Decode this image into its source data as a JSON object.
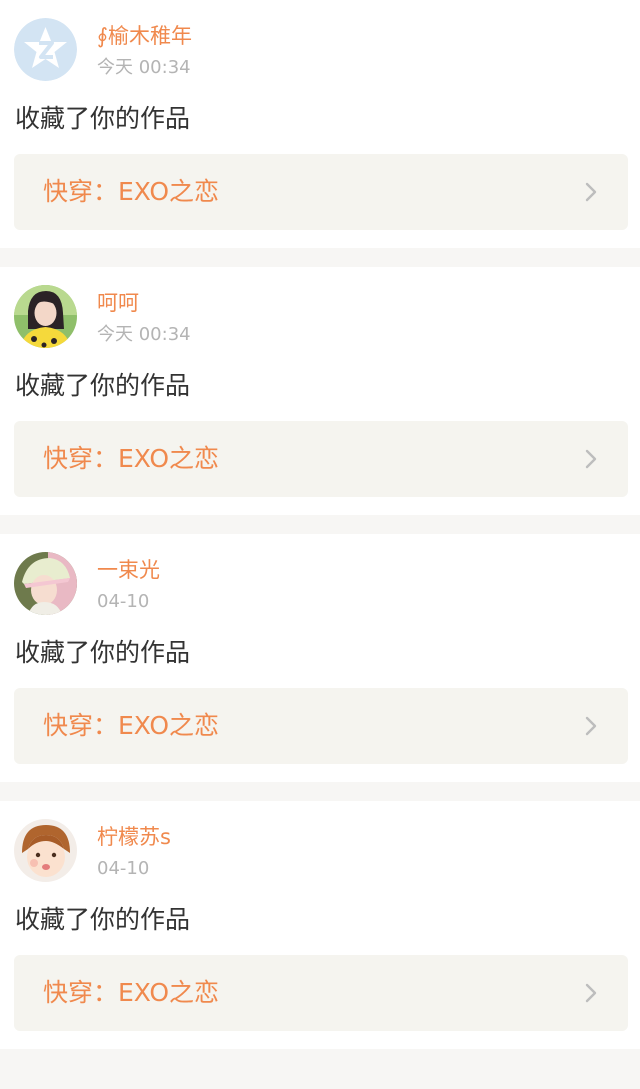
{
  "feed": [
    {
      "user": "∮榆木稚年",
      "time": "今天 00:34",
      "action": "收藏了你的作品",
      "work_title": "快穿：EXO之恋",
      "avatar": "default-star-avatar"
    },
    {
      "user": "呵呵",
      "time": "今天 00:34",
      "action": "收藏了你的作品",
      "work_title": "快穿：EXO之恋",
      "avatar": "girl-photo-avatar"
    },
    {
      "user": "一束光",
      "time": "04-10",
      "action": "收藏了你的作品",
      "work_title": "快穿：EXO之恋",
      "avatar": "girl-hat-photo-avatar"
    },
    {
      "user": "柠檬苏s",
      "time": "04-10",
      "action": "收藏了你的作品",
      "work_title": "快穿：EXO之恋",
      "avatar": "child-photo-avatar"
    }
  ],
  "colors": {
    "accent": "#f0894d",
    "time": "#b4b4b4",
    "text": "#333333",
    "work_bg": "#f5f4ef",
    "divider": "#f7f6f4"
  },
  "icons": {
    "chevron": "chevron-right-icon"
  }
}
